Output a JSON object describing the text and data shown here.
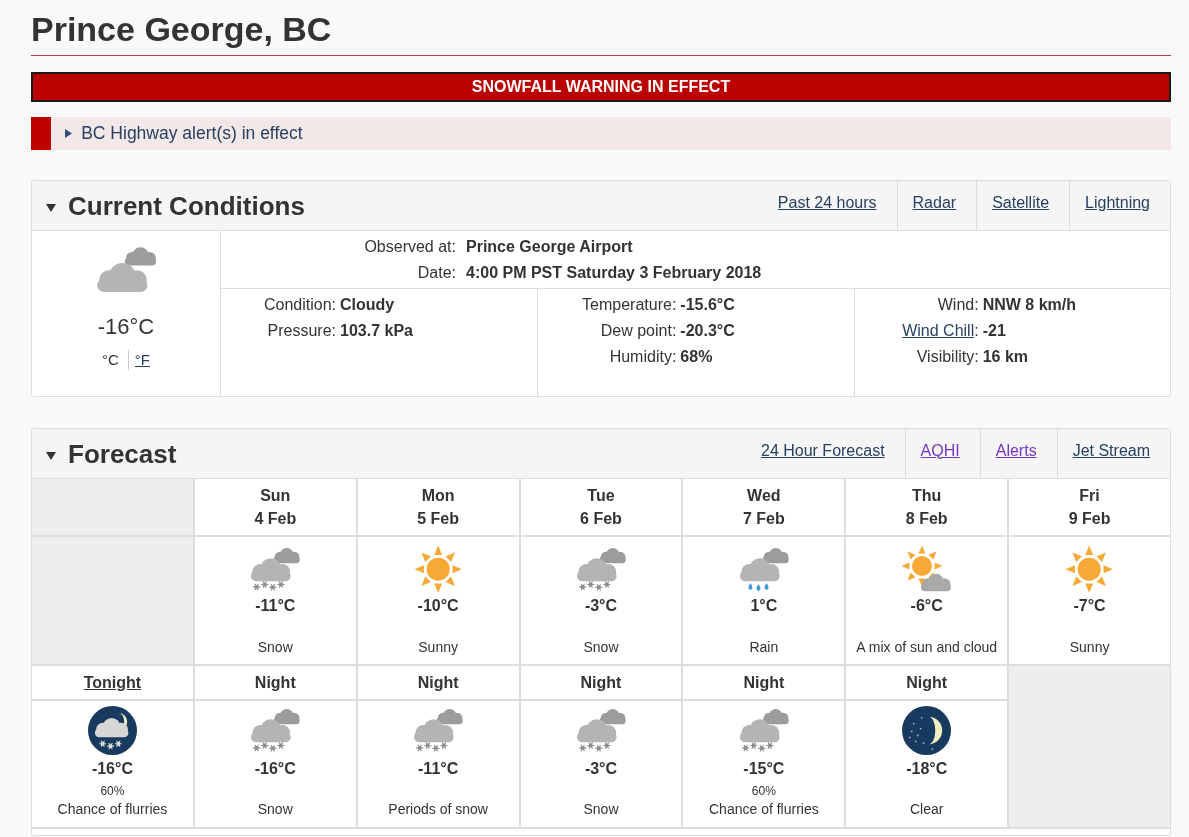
{
  "location": {
    "title": "Prince George, BC"
  },
  "warning": {
    "text": "SNOWFALL WARNING IN EFFECT"
  },
  "highway_alert": {
    "text": "BC Highway alert(s) in effect",
    "expanded": false
  },
  "current_conditions": {
    "title": "Current Conditions",
    "expanded": true,
    "links": [
      {
        "label": "Past 24 hours",
        "visited": false
      },
      {
        "label": "Radar",
        "visited": false
      },
      {
        "label": "Satellite",
        "visited": false
      },
      {
        "label": "Lightning",
        "visited": false
      }
    ],
    "summary": {
      "kind": "cloudy",
      "temperature": "-16°C",
      "units": [
        {
          "label": "°C",
          "selected": true
        },
        {
          "label": "°F",
          "selected": false
        }
      ]
    },
    "station": [
      {
        "label": "Observed at:",
        "value": "Prince George Airport"
      },
      {
        "label": "Date:",
        "value": "4:00 PM PST Saturday 3 February 2018"
      }
    ],
    "observations": [
      {
        "rows": [
          {
            "label": "Condition:",
            "value": "Cloudy",
            "link": false
          },
          {
            "label": "Pressure:",
            "value": "103.7 kPa",
            "link": false
          }
        ]
      },
      {
        "rows": [
          {
            "label": "Temperature:",
            "value": "-15.6°C",
            "link": false
          },
          {
            "label": "Dew point:",
            "value": "-20.3°C",
            "link": false
          },
          {
            "label": "Humidity:",
            "value": "68%",
            "link": false
          }
        ]
      },
      {
        "rows": [
          {
            "label": "Wind:",
            "value": "NNW 8 km/h",
            "link": false
          },
          {
            "label": "Wind Chill",
            "suffix": ":",
            "value": "-21",
            "link": true
          },
          {
            "label": "Visibility:",
            "value": "16 km",
            "link": false
          }
        ]
      }
    ]
  },
  "forecast": {
    "title": "Forecast",
    "expanded": true,
    "links": [
      {
        "label": "24 Hour Forecast",
        "visited": false
      },
      {
        "label": "AQHI",
        "visited": true
      },
      {
        "label": "Alerts",
        "visited": true
      },
      {
        "label": "Jet Stream",
        "visited": false
      }
    ],
    "days": [
      {
        "day": "Sun",
        "date": "4 Feb",
        "kind": "snow",
        "temperature": "-11°C",
        "condition": "Snow"
      },
      {
        "day": "Mon",
        "date": "5 Feb",
        "kind": "sunny",
        "temperature": "-10°C",
        "condition": "Sunny"
      },
      {
        "day": "Tue",
        "date": "6 Feb",
        "kind": "snow",
        "temperature": "-3°C",
        "condition": "Snow"
      },
      {
        "day": "Wed",
        "date": "7 Feb",
        "kind": "rain",
        "temperature": "1°C",
        "condition": "Rain"
      },
      {
        "day": "Thu",
        "date": "8 Feb",
        "kind": "sun-cloud",
        "temperature": "-6°C",
        "condition": "A mix of sun and cloud"
      },
      {
        "day": "Fri",
        "date": "9 Feb",
        "kind": "sunny",
        "temperature": "-7°C",
        "condition": "Sunny"
      }
    ],
    "nights": [
      {
        "label": "Tonight",
        "link": true,
        "kind": "night-snow",
        "temperature": "-16°C",
        "pop": "60%",
        "condition": "Chance of flurries"
      },
      {
        "label": "Night",
        "link": false,
        "kind": "snow",
        "temperature": "-16°C",
        "condition": "Snow"
      },
      {
        "label": "Night",
        "link": false,
        "kind": "snow",
        "temperature": "-11°C",
        "condition": "Periods of snow"
      },
      {
        "label": "Night",
        "link": false,
        "kind": "snow",
        "temperature": "-3°C",
        "condition": "Snow"
      },
      {
        "label": "Night",
        "link": false,
        "kind": "snow",
        "temperature": "-15°C",
        "pop": "60%",
        "condition": "Chance of flurries"
      },
      {
        "label": "Night",
        "link": false,
        "kind": "clear-night",
        "temperature": "-18°C",
        "condition": "Clear"
      }
    ]
  }
}
